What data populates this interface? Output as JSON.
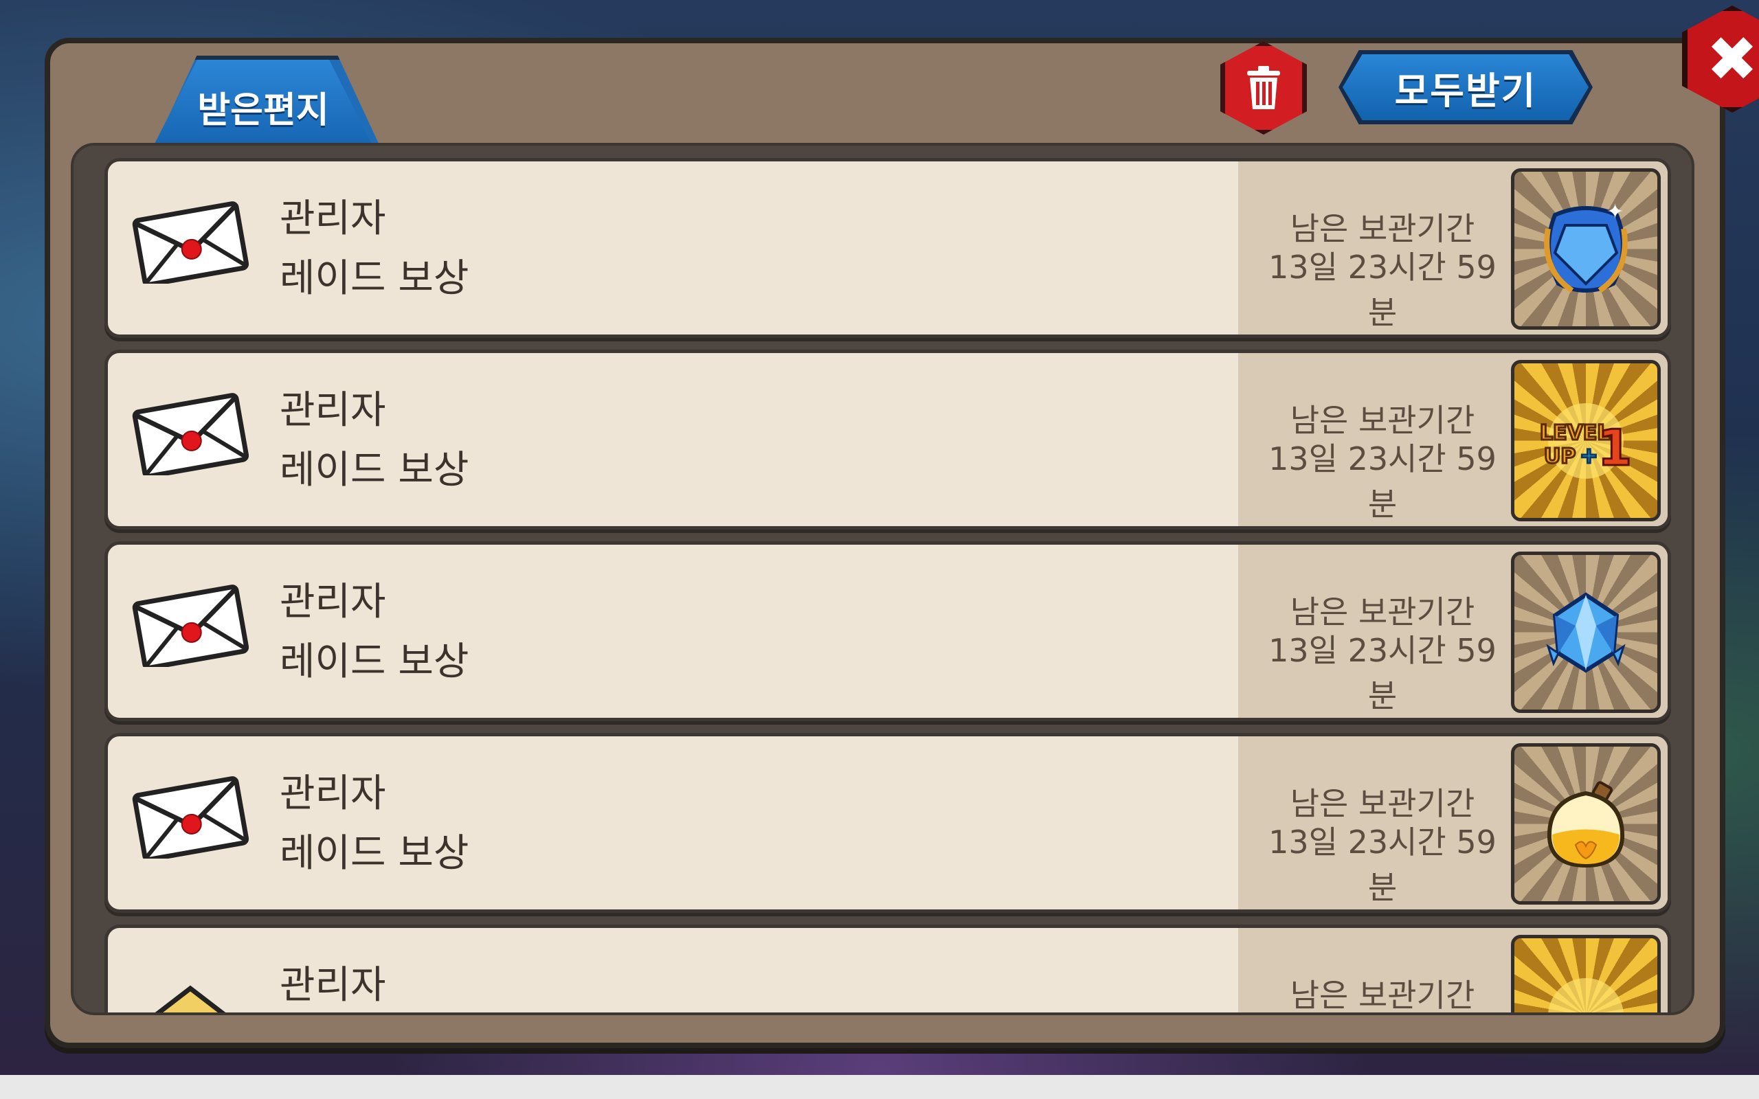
{
  "tab": {
    "label": "받은편지"
  },
  "toolbar": {
    "receive_all_label": "모두받기"
  },
  "icons": {
    "trash": "trash-icon",
    "close": "close-icon",
    "mail": "envelope-icon"
  },
  "mails": [
    {
      "sender": "관리자",
      "subject": "레이드 보상",
      "keep_label": "남은 보관기간",
      "keep_time": "13일 23시간 59분",
      "item": "blue-gem-emblem"
    },
    {
      "sender": "관리자",
      "subject": "레이드 보상",
      "keep_label": "남은 보관기간",
      "keep_time": "13일 23시간 59분",
      "item": "level-up-ticket",
      "item_text": "LEVEL UP+1"
    },
    {
      "sender": "관리자",
      "subject": "레이드 보상",
      "keep_label": "남은 보관기간",
      "keep_time": "13일 23시간 59분",
      "item": "blue-crystal"
    },
    {
      "sender": "관리자",
      "subject": "레이드 보상",
      "keep_label": "남은 보관기간",
      "keep_time": "13일 23시간 59분",
      "item": "yellow-potion"
    },
    {
      "sender": "관리자",
      "subject": "",
      "keep_label": "남은 보관기간",
      "keep_time": "",
      "item": "level-up-ticket"
    }
  ],
  "colors": {
    "panel": "#8d7866",
    "tab_blue": "#1f6db8",
    "trash_red": "#d21e23",
    "close_red": "#c4151b",
    "row_bg": "#efe5d6",
    "row_side": "#d9cab5"
  }
}
